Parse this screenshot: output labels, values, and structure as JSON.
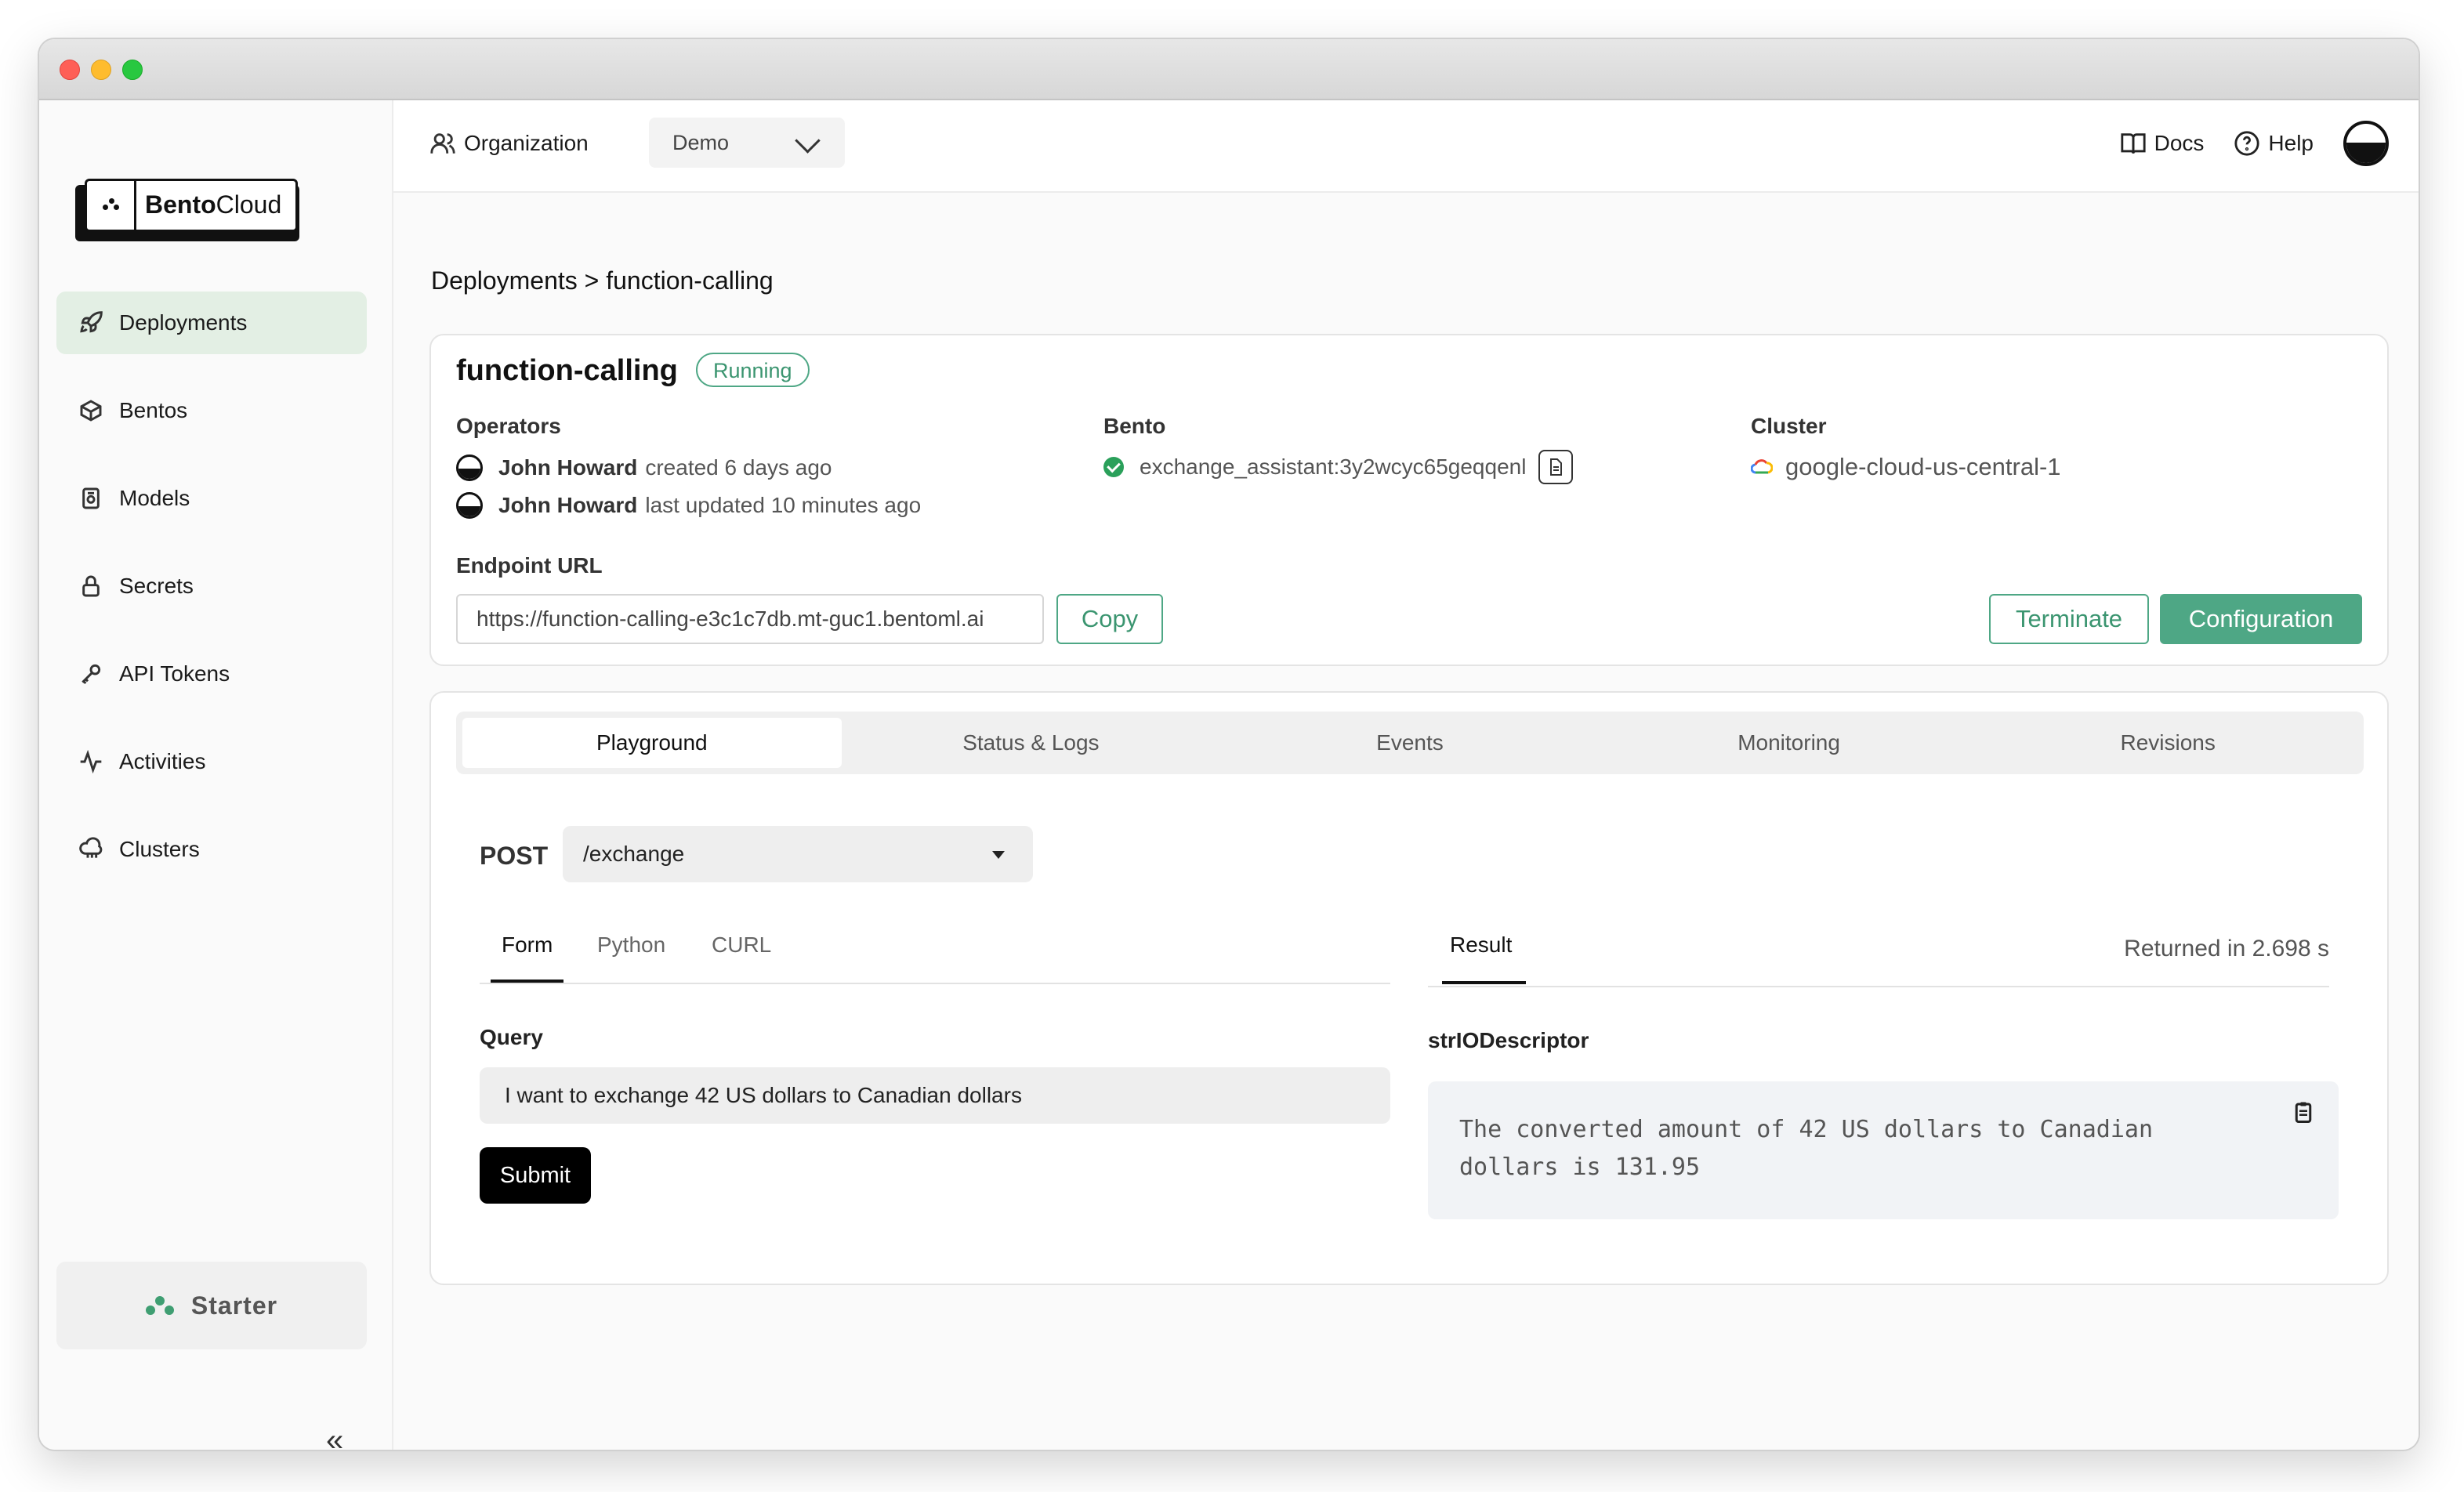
{
  "sidebar": {
    "logo": {
      "bold": "Bento",
      "rest": "Cloud"
    },
    "items": [
      {
        "label": "Deployments",
        "icon": "rocket-icon",
        "active": true
      },
      {
        "label": "Bentos",
        "icon": "box-icon"
      },
      {
        "label": "Models",
        "icon": "model-icon"
      },
      {
        "label": "Secrets",
        "icon": "lock-icon"
      },
      {
        "label": "API Tokens",
        "icon": "key-icon"
      },
      {
        "label": "Activities",
        "icon": "activity-icon"
      },
      {
        "label": "Clusters",
        "icon": "cloud-icon"
      }
    ],
    "plan": "Starter",
    "collapse_glyph": "«"
  },
  "topbar": {
    "org_label": "Organization",
    "org_value": "Demo",
    "docs": "Docs",
    "help": "Help"
  },
  "breadcrumb": "Deployments > function-calling",
  "deployment": {
    "name": "function-calling",
    "status": "Running",
    "operators_label": "Operators",
    "operators": [
      {
        "name": "John Howard",
        "action": "created 6 days ago"
      },
      {
        "name": "John Howard",
        "action": "last updated 10 minutes ago"
      }
    ],
    "bento_label": "Bento",
    "bento": "exchange_assistant:3y2wcyc65geqqenl",
    "cluster_label": "Cluster",
    "cluster": "google-cloud-us-central-1",
    "endpoint_label": "Endpoint URL",
    "endpoint_url": "https://function-calling-e3c1c7db.mt-guc1.bentoml.ai",
    "copy": "Copy",
    "terminate": "Terminate",
    "configuration": "Configuration"
  },
  "tabs": [
    "Playground",
    "Status & Logs",
    "Events",
    "Monitoring",
    "Revisions"
  ],
  "playground": {
    "method": "POST",
    "endpoint": "/exchange",
    "input_tabs": [
      "Form",
      "Python",
      "CURL"
    ],
    "query_label": "Query",
    "query_value": "I want to exchange 42 US dollars to Canadian dollars",
    "submit": "Submit",
    "result_tab": "Result",
    "returned": "Returned in 2.698 s",
    "descriptor": "strIODescriptor",
    "result": "The converted amount of 42 US dollars to Canadian dollars is 131.95"
  },
  "colors": {
    "accent": "#4ea785",
    "active_nav": "#e3efe4"
  }
}
